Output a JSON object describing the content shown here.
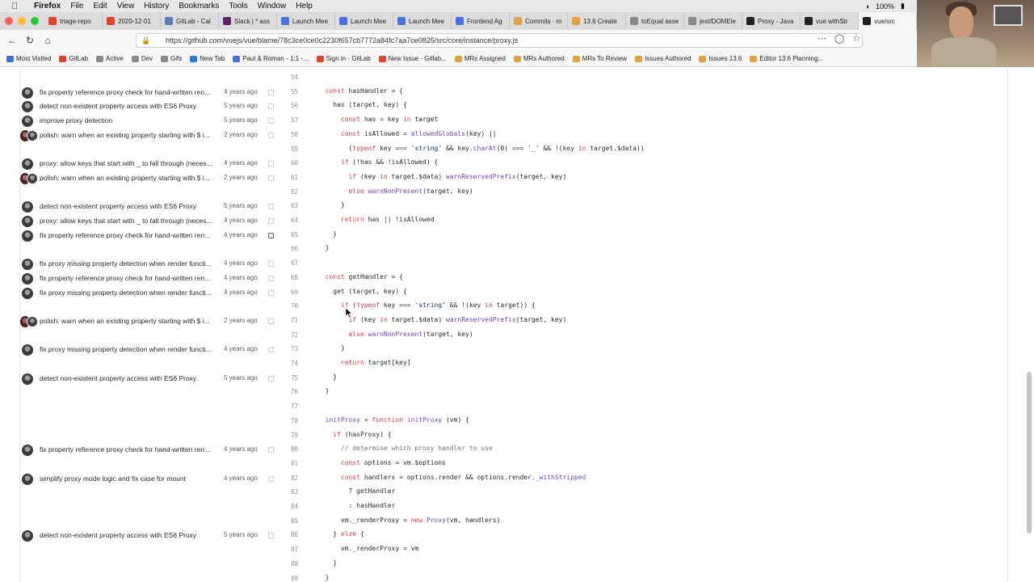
{
  "menubar": {
    "app": "Firefox",
    "items": [
      "File",
      "Edit",
      "View",
      "History",
      "Bookmarks",
      "Tools",
      "Window",
      "Help"
    ],
    "battery": "100%"
  },
  "tabs": [
    {
      "label": "triage-repo",
      "color": "#e24329"
    },
    {
      "label": "2020-12-01",
      "color": "#e24329"
    },
    {
      "label": "GitLab - Cal",
      "color": "#5b7fb9"
    },
    {
      "label": "Slack | * ass",
      "color": "#611f69"
    },
    {
      "label": "Launch Mee",
      "color": "#4a6fe0"
    },
    {
      "label": "Launch Mee",
      "color": "#4a6fe0"
    },
    {
      "label": "Launch Mee",
      "color": "#4a6fe0"
    },
    {
      "label": "Frontend Ag",
      "color": "#4a6fe0"
    },
    {
      "label": "Commits · m",
      "color": "#e2a03f"
    },
    {
      "label": "13.6 Create",
      "color": "#e2a03f"
    },
    {
      "label": "toEqual asse",
      "color": "#888888"
    },
    {
      "label": "jest/DOMEle",
      "color": "#888888"
    },
    {
      "label": "Proxy - Java",
      "color": "#222222"
    },
    {
      "label": "vue withStr",
      "color": "#222222"
    },
    {
      "label": "vue/src",
      "color": "#222222"
    }
  ],
  "url": "https://github.com/vuejs/vue/blame/78c3ce0ce0c2230f657cb7772a84fc7aa7ce0825/src/core/instance/proxy.js",
  "bookmarks": [
    "Most Visited",
    "GitLab",
    "Active",
    "Dev",
    "Gifs",
    "New Tab",
    "Paul & Roman - 1:1 -...",
    "Sign in · GitLab",
    "New Issue · Gitlab...",
    "MRs Assigned",
    "MRs Authored",
    "MRs To Review",
    "Issues Authored",
    "Issues 13.6",
    "Editor 13.6 Planning..."
  ],
  "blame": [
    {
      "line": "54",
      "code": ""
    },
    {
      "line": "55",
      "code": "  const hasHandler = {",
      "commit": "fix property reference proxy check for hand-written ren...",
      "age": "4 years ago"
    },
    {
      "line": "56",
      "code": "    has (target, key) {",
      "commit": "detect non-existent property access with ES6 Proxy",
      "age": "5 years ago"
    },
    {
      "line": "57",
      "code": "      const has = key in target",
      "commit": "improve proxy detection",
      "age": "5 years ago"
    },
    {
      "line": "58",
      "code": "      const isAllowed = allowedGlobals(key) ||",
      "commit": "polish: warn when an existing property starting with $ i...",
      "age": "2 years ago",
      "double": true
    },
    {
      "line": "59",
      "code": "        (typeof key === 'string' && key.charAt(0) === '_' && !(key in target.$data))"
    },
    {
      "line": "60",
      "code": "      if (!has && !isAllowed) {",
      "commit": "proxy: allow keys that start with _ to fall through (neces...",
      "age": "4 years ago"
    },
    {
      "line": "61",
      "code": "        if (key in target.$data) warnReservedPrefix(target, key)",
      "commit": "polish: warn when an existing property starting with $ i...",
      "age": "2 years ago",
      "double": true
    },
    {
      "line": "62",
      "code": "        else warnNonPresent(target, key)"
    },
    {
      "line": "63",
      "code": "      }",
      "commit": "detect non-existent property access with ES6 Proxy",
      "age": "5 years ago"
    },
    {
      "line": "64",
      "code": "      return has || !isAllowed",
      "commit": "proxy: allow keys that start with _ to fall through (neces...",
      "age": "4 years ago"
    },
    {
      "line": "65",
      "code": "    }",
      "commit": "fix property reference proxy check for hand-written ren...",
      "age": "4 years ago",
      "hover": true
    },
    {
      "line": "66",
      "code": "  }"
    },
    {
      "line": "67",
      "code": "",
      "commit": "fix proxy missing property detection when render functi...",
      "age": "4 years ago"
    },
    {
      "line": "68",
      "code": "  const getHandler = {",
      "commit": "fix property reference proxy check for hand-written ren...",
      "age": "4 years ago"
    },
    {
      "line": "69",
      "code": "    get (target, key) {",
      "commit": "fix proxy missing property detection when render functi...",
      "age": "4 years ago"
    },
    {
      "line": "70",
      "code": "      if (typeof key === 'string' && !(key in target)) {"
    },
    {
      "line": "71",
      "code": "        if (key in target.$data) warnReservedPrefix(target, key)",
      "commit": "polish: warn when an existing property starting with $ i...",
      "age": "2 years ago",
      "double": true
    },
    {
      "line": "72",
      "code": "        else warnNonPresent(target, key)"
    },
    {
      "line": "73",
      "code": "      }",
      "commit": "fix proxy missing property detection when render functi...",
      "age": "4 years ago"
    },
    {
      "line": "74",
      "code": "      return target[key]"
    },
    {
      "line": "75",
      "code": "    }",
      "commit": "detect non-existent property access with ES6 Proxy",
      "age": "5 years ago"
    },
    {
      "line": "76",
      "code": "  }"
    },
    {
      "line": "77",
      "code": ""
    },
    {
      "line": "78",
      "code": "  initProxy = function initProxy (vm) {"
    },
    {
      "line": "79",
      "code": "    if (hasProxy) {"
    },
    {
      "line": "80",
      "code": "      // determine which proxy handler to use",
      "commit": "fix property reference proxy check for hand-written ren...",
      "age": "4 years ago"
    },
    {
      "line": "81",
      "code": "      const options = vm.$options"
    },
    {
      "line": "82",
      "code": "      const handlers = options.render && options.render._withStripped",
      "commit": "simplify proxy mode logic and fix case for mount",
      "age": "4 years ago"
    },
    {
      "line": "83",
      "code": "        ? getHandler"
    },
    {
      "line": "84",
      "code": "        : hasHandler"
    },
    {
      "line": "85",
      "code": "      vm._renderProxy = new Proxy(vm, handlers)"
    },
    {
      "line": "86",
      "code": "    } else {",
      "commit": "detect non-existent property access with ES6 Proxy",
      "age": "5 years ago"
    },
    {
      "line": "87",
      "code": "      vm._renderProxy = vm"
    },
    {
      "line": "88",
      "code": "    }"
    },
    {
      "line": "89",
      "code": "  }"
    }
  ]
}
